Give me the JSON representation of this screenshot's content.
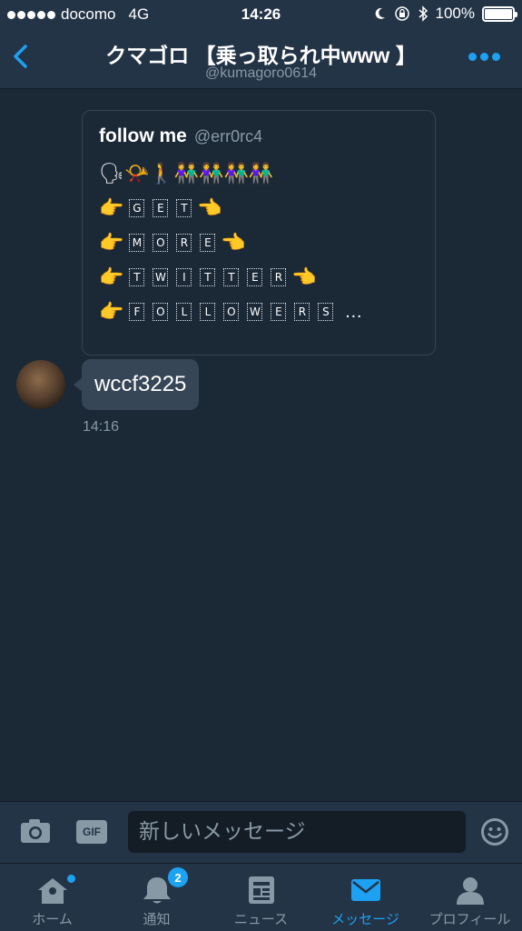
{
  "status_bar": {
    "carrier": "docomo",
    "network": "4G",
    "time": "14:26",
    "battery": "100%"
  },
  "header": {
    "title": "クマゴロ 【乗っ取られ中www 】",
    "handle": "@kumagoro0614"
  },
  "quoted_tweet": {
    "name": "follow me",
    "handle": "@err0rc4",
    "lines": [
      {
        "letters": [
          "G",
          "E",
          "T"
        ]
      },
      {
        "letters": [
          "M",
          "O",
          "R",
          "E"
        ]
      },
      {
        "letters": [
          "T",
          "W",
          "I",
          "T",
          "T",
          "E",
          "R"
        ]
      },
      {
        "letters": [
          "F",
          "O",
          "L",
          "L",
          "O",
          "W",
          "E",
          "R",
          "S"
        ],
        "suffix": "…"
      }
    ]
  },
  "message": {
    "text": "wccf3225",
    "time": "14:16"
  },
  "compose": {
    "gif_label": "GIF",
    "placeholder": "新しいメッセージ"
  },
  "tabs": [
    {
      "label": "ホーム",
      "icon": "home-icon"
    },
    {
      "label": "通知",
      "icon": "bell-icon",
      "badge": "2"
    },
    {
      "label": "ニュース",
      "icon": "news-icon"
    },
    {
      "label": "メッセージ",
      "icon": "mail-icon",
      "active": true
    },
    {
      "label": "プロフィール",
      "icon": "person-icon"
    }
  ],
  "colors": {
    "accent": "#1da1f2",
    "background": "#1b2836",
    "bar": "#243447",
    "secondary_text": "#8899a6"
  }
}
